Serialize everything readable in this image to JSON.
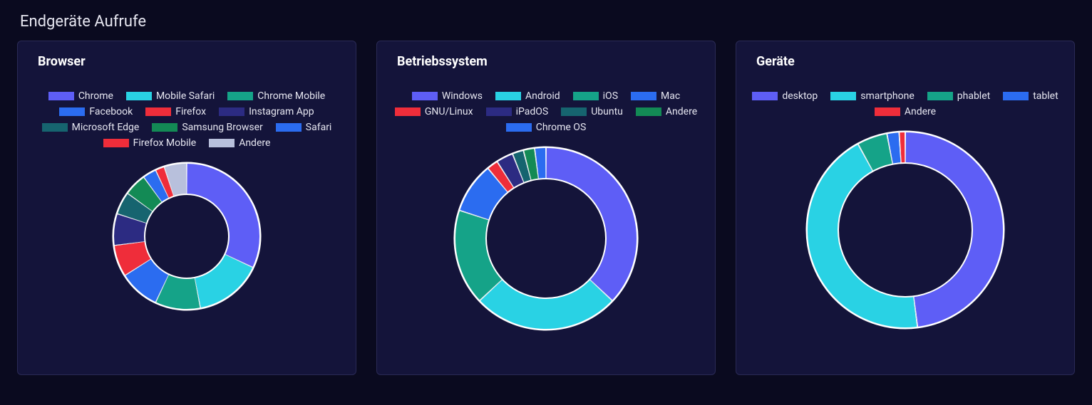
{
  "section_title": "Endgeräte Aufrufe",
  "cards": [
    {
      "id": "browser",
      "title": "Browser"
    },
    {
      "id": "os",
      "title": "Betriebssystem"
    },
    {
      "id": "devices",
      "title": "Geräte"
    }
  ],
  "chart_data": [
    {
      "id": "browser",
      "type": "pie",
      "title": "Browser",
      "series": [
        {
          "name": "Chrome",
          "value": 32,
          "color": "#5e5ef6"
        },
        {
          "name": "Mobile Safari",
          "value": 15,
          "color": "#29d2e4"
        },
        {
          "name": "Chrome Mobile",
          "value": 10,
          "color": "#15a388"
        },
        {
          "name": "Facebook",
          "value": 9,
          "color": "#2b6cf0"
        },
        {
          "name": "Firefox",
          "value": 7,
          "color": "#ef2d3a"
        },
        {
          "name": "Instagram App",
          "value": 7,
          "color": "#2c2b82"
        },
        {
          "name": "Microsoft Edge",
          "value": 5,
          "color": "#16646f"
        },
        {
          "name": "Samsung Browser",
          "value": 5,
          "color": "#138a55"
        },
        {
          "name": "Safari",
          "value": 3,
          "color": "#2b6cf0"
        },
        {
          "name": "Firefox Mobile",
          "value": 2,
          "color": "#ef2d3a"
        },
        {
          "name": "Andere",
          "value": 5,
          "color": "#b8c0dc"
        }
      ]
    },
    {
      "id": "os",
      "type": "pie",
      "title": "Betriebssystem",
      "series": [
        {
          "name": "Windows",
          "value": 37,
          "color": "#5e5ef6"
        },
        {
          "name": "Android",
          "value": 26,
          "color": "#29d2e4"
        },
        {
          "name": "iOS",
          "value": 17,
          "color": "#15a388"
        },
        {
          "name": "Mac",
          "value": 9,
          "color": "#2b6cf0"
        },
        {
          "name": "GNU/Linux",
          "value": 2,
          "color": "#ef2d3a"
        },
        {
          "name": "iPadOS",
          "value": 3,
          "color": "#2c2b82"
        },
        {
          "name": "Ubuntu",
          "value": 2,
          "color": "#16646f"
        },
        {
          "name": "Andere",
          "value": 2,
          "color": "#138a55"
        },
        {
          "name": "Chrome OS",
          "value": 2,
          "color": "#2b6cf0"
        }
      ]
    },
    {
      "id": "devices",
      "type": "pie",
      "title": "Geräte",
      "series": [
        {
          "name": "desktop",
          "value": 48,
          "color": "#5e5ef6"
        },
        {
          "name": "smartphone",
          "value": 44,
          "color": "#29d2e4"
        },
        {
          "name": "phablet",
          "value": 5,
          "color": "#15a388"
        },
        {
          "name": "tablet",
          "value": 2,
          "color": "#2b6cf0"
        },
        {
          "name": "Andere",
          "value": 1,
          "color": "#ef2d3a"
        }
      ]
    }
  ],
  "donut": {
    "sizes": {
      "browser": 210,
      "os": 260,
      "devices": 280
    },
    "stroke": 44,
    "holeColor": "#14143a",
    "sepColor": "#ffffff"
  }
}
